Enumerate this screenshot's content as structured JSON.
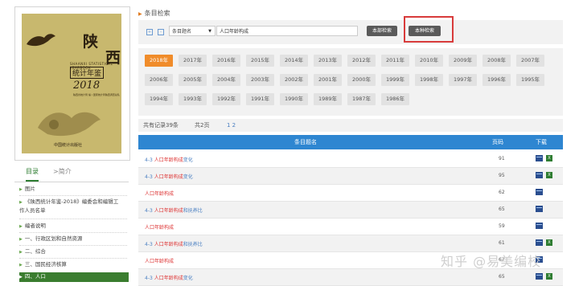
{
  "cover": {
    "title_char1": "陕",
    "title_char2": "西",
    "subtitle_en": "SHAANXI STATISTICAL YEARBOOK",
    "yearbook_label": "统计年鉴",
    "year": "2018",
    "editor": "陕西省统计局 编 / 国家统计局陕西调查总队",
    "publisher": "中国统计出版社"
  },
  "tabs": {
    "catalog": "目录",
    "intro": ">简介"
  },
  "sidebar": {
    "items": [
      {
        "label": "图片"
      },
      {
        "label": "《陕西统计年鉴-2018》编委会和编辑工作人员名单"
      },
      {
        "label": "编者说明"
      },
      {
        "label": "一、行政区划和自然资源"
      },
      {
        "label": "二、综合"
      },
      {
        "label": "三、国民经济核算"
      },
      {
        "label": "四、人口",
        "active": true
      }
    ]
  },
  "section_title": "条目检索",
  "search": {
    "field": "条目题名",
    "query": "人口年龄构成",
    "btn_all": "本部检索",
    "btn_this": "本种检索"
  },
  "years": [
    "2018年",
    "2017年",
    "2016年",
    "2015年",
    "2014年",
    "2013年",
    "2012年",
    "2011年",
    "2010年",
    "2009年",
    "2008年",
    "2007年",
    "2006年",
    "2005年",
    "2004年",
    "2003年",
    "2002年",
    "2001年",
    "2000年",
    "1999年",
    "1998年",
    "1997年",
    "1996年",
    "1995年",
    "1994年",
    "1993年",
    "1992年",
    "1991年",
    "1990年",
    "1989年",
    "1987年",
    "1986年"
  ],
  "selected_year": "2018年",
  "records": {
    "total": "共有记录39条",
    "pages": "共2页",
    "links": "1 2"
  },
  "table": {
    "headers": {
      "name": "条目题名",
      "page": "页码",
      "download": "下载"
    },
    "rows": [
      {
        "code": "4-3",
        "kw": "人口年龄构成",
        "rest": "变化",
        "page": "91",
        "xls": true
      },
      {
        "code": "4-3",
        "kw": "人口年龄构成",
        "rest": "变化",
        "page": "95",
        "xls": true
      },
      {
        "code": "",
        "kw": "人口年龄构成",
        "rest": "",
        "page": "62",
        "xls": false
      },
      {
        "code": "4-3",
        "kw": "人口年龄构成",
        "rest": "和抚养比",
        "page": "65",
        "xls": false
      },
      {
        "code": "",
        "kw": "人口年龄构成",
        "rest": "",
        "page": "59",
        "xls": false
      },
      {
        "code": "4-3",
        "kw": "人口年龄构成",
        "rest": "和抚养比",
        "page": "61",
        "xls": true
      },
      {
        "code": "",
        "kw": "人口年龄构成",
        "rest": "",
        "page": "62",
        "xls": false
      },
      {
        "code": "4-3",
        "kw": "人口年龄构成",
        "rest": "变化",
        "page": "65",
        "xls": true
      }
    ]
  },
  "watermark": "知乎 @易美编校",
  "colors": {
    "accent_green": "#3a7d2f",
    "table_header_blue": "#2e86d1",
    "selected_year_orange": "#f08c2a",
    "highlight_red": "#d83b3b"
  }
}
